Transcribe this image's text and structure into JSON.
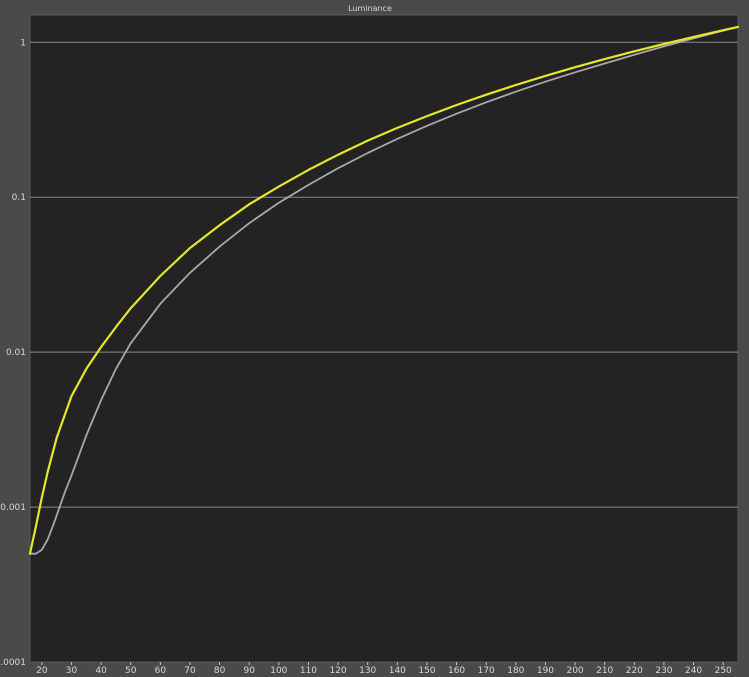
{
  "chart_data": {
    "type": "line",
    "title": "Luminance",
    "xlabel": "",
    "ylabel": "",
    "xlim": [
      16,
      255
    ],
    "ylim": [
      0.0001,
      1.5
    ],
    "yscale": "log",
    "grid": "horizontal",
    "x_ticks": [
      20,
      30,
      40,
      50,
      60,
      70,
      80,
      90,
      100,
      110,
      120,
      130,
      140,
      150,
      160,
      170,
      180,
      190,
      200,
      210,
      220,
      230,
      240,
      250
    ],
    "y_ticks": [
      {
        "value": 1,
        "label": "1"
      },
      {
        "value": 0.1,
        "label": "0.1"
      },
      {
        "value": 0.01,
        "label": "0.01"
      },
      {
        "value": 0.001,
        "label": "0.001"
      },
      {
        "value": 0.0001,
        "label": "0.0001"
      }
    ],
    "series": [
      {
        "color": "#e6e62a",
        "x": [
          16,
          18,
          20,
          22,
          25,
          30,
          35,
          40,
          45,
          50,
          60,
          70,
          80,
          90,
          100,
          110,
          120,
          130,
          140,
          150,
          160,
          170,
          180,
          190,
          200,
          210,
          220,
          230,
          240,
          250,
          255
        ],
        "y": [
          0.0005,
          0.00075,
          0.00115,
          0.0017,
          0.0028,
          0.0052,
          0.0078,
          0.0108,
          0.0145,
          0.0192,
          0.031,
          0.047,
          0.066,
          0.09,
          0.117,
          0.15,
          0.188,
          0.232,
          0.28,
          0.334,
          0.394,
          0.459,
          0.53,
          0.607,
          0.69,
          0.779,
          0.874,
          0.975,
          1.083,
          1.197,
          1.257
        ]
      },
      {
        "color": "#a8a8a8",
        "x": [
          16,
          18,
          20,
          22,
          24,
          26,
          28,
          30,
          35,
          40,
          45,
          50,
          60,
          70,
          80,
          90,
          100,
          110,
          120,
          130,
          140,
          150,
          160,
          170,
          180,
          190,
          200,
          210,
          220,
          230,
          240,
          250,
          255
        ],
        "y": [
          0.0005,
          0.0005,
          0.00053,
          0.00062,
          0.00078,
          0.001,
          0.00128,
          0.0016,
          0.0029,
          0.0049,
          0.0078,
          0.0114,
          0.0205,
          0.0325,
          0.048,
          0.068,
          0.092,
          0.12,
          0.154,
          0.193,
          0.238,
          0.289,
          0.346,
          0.41,
          0.48,
          0.557,
          0.64,
          0.73,
          0.83,
          0.94,
          1.06,
          1.19,
          1.257
        ]
      }
    ]
  }
}
